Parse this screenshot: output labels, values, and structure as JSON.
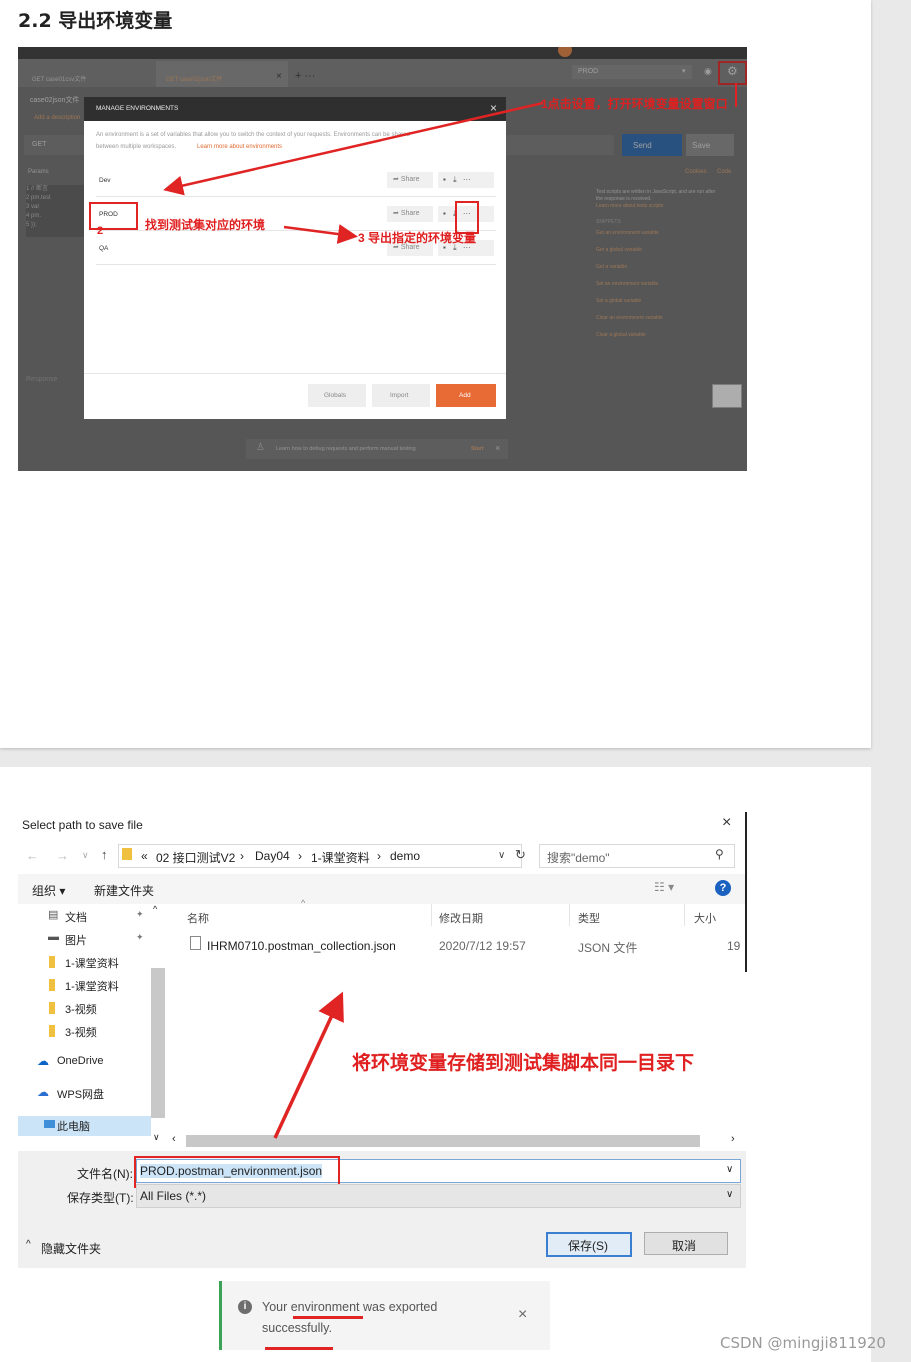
{
  "heading": "2.2 导出环境变量",
  "postman": {
    "tabs": [
      "GET case01csv文件",
      "GET case02json文件"
    ],
    "env_select": "PROD",
    "collection_name": "case02json文件",
    "add_description": "Add a description",
    "method": "GET",
    "send_label": "Send",
    "save_label": "Save",
    "params_label": "Params",
    "cookies_label": "Cookies",
    "code_label": "Code",
    "code_lines": [
      "1  // 断言",
      "2  pm.test",
      "3     var",
      "4     pm.",
      "5  });"
    ],
    "response_label": "Response",
    "snippets": {
      "desc": "Test scripts are written in JavaScript, and are run after the response is received.",
      "learn_more": "Learn more about tests scripts",
      "title": "SNIPPETS",
      "items": [
        "Get an environment variable",
        "Get a global variable",
        "Get a variable",
        "Set an environment variable",
        "Set a global variable",
        "Clear an environment variable",
        "Clear a global variable"
      ]
    },
    "tip_text": "Learn how to debug requests and perform manual testing",
    "tip_start": "Start",
    "modal": {
      "title": "MANAGE ENVIRONMENTS",
      "desc1": "An environment is a set of variables that allow you to switch the context of your requests. Environments can be shared",
      "desc2": "between multiple workspaces.",
      "learn_more": "Learn more about environments",
      "envs": [
        "Dev",
        "PROD",
        "QA"
      ],
      "share_label": "Share",
      "globals_label": "Globals",
      "import_label": "Import",
      "add_label": "Add"
    },
    "annotations": {
      "a1": "1点击设置，打开环境变量设置窗口",
      "a2_num": "2",
      "a2": "找到测试集对应的环境",
      "a3": "3 导出指定的环境变量"
    }
  },
  "dialog": {
    "title": "Select path to save file",
    "breadcrumb": [
      "02 接口测试V2",
      "Day04",
      "1-课堂资料",
      "demo"
    ],
    "breadcrumb_prefix": "«",
    "search_placeholder": "搜索\"demo\"",
    "organize": "组织 ▾",
    "new_folder": "新建文件夹",
    "sidebar": [
      "文档",
      "图片",
      "1-课堂资料",
      "1-课堂资料",
      "3-视频",
      "3-视频",
      "OneDrive",
      "WPS网盘",
      "此电脑"
    ],
    "columns": [
      "名称",
      "修改日期",
      "类型",
      "大小"
    ],
    "file": {
      "name": "IHRM0710.postman_collection.json",
      "date": "2020/7/12 19:57",
      "type": "JSON 文件",
      "size": "19"
    },
    "annotation": "将环境变量存储到测试集脚本同一目录下",
    "filename_label": "文件名(N):",
    "filename_value": "PROD.postman_environment.json",
    "filetype_label": "保存类型(T):",
    "filetype_value": "All Files (*.*)",
    "hide_folders": "隐藏文件夹",
    "save_button": "保存(S)",
    "cancel_button": "取消"
  },
  "toast": {
    "message_line1": "Your environment was exported",
    "message_line2": "successfully."
  },
  "watermark": "CSDN @mingji811920"
}
